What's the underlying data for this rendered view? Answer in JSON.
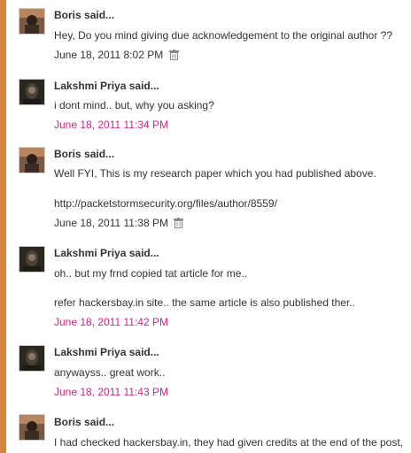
{
  "comments": [
    {
      "author": "Boris",
      "said": "said...",
      "lines": [
        "Hey, Do you mind giving due acknowledgement to the original author ??"
      ],
      "timestamp": "June 18, 2011 8:02 PM",
      "deletable": true,
      "avatar_icon": "boris-avatar-icon"
    },
    {
      "author": "Lakshmi Priya",
      "said": "said...",
      "lines": [
        "i dont mind.. but, why you asking?"
      ],
      "timestamp": "June 18, 2011 11:34 PM",
      "deletable": false,
      "avatar_icon": "lakshmi-avatar-icon"
    },
    {
      "author": "Boris",
      "said": "said...",
      "lines": [
        "Well FYI, This is my research paper which you had published above.",
        "http://packetstormsecurity.org/files/author/8559/"
      ],
      "timestamp": "June 18, 2011 11:38 PM",
      "deletable": true,
      "avatar_icon": "boris-avatar-icon"
    },
    {
      "author": "Lakshmi Priya",
      "said": "said...",
      "lines": [
        "oh.. but my frnd copied tat article for me..",
        "refer hackersbay.in site.. the same article is also published ther.."
      ],
      "timestamp": "June 18, 2011 11:42 PM",
      "deletable": false,
      "avatar_icon": "lakshmi-avatar-icon"
    },
    {
      "author": "Lakshmi Priya",
      "said": "said...",
      "lines": [
        "anywayss.. great work.."
      ],
      "timestamp": "June 18, 2011 11:43 PM",
      "deletable": false,
      "avatar_icon": "lakshmi-avatar-icon"
    },
    {
      "author": "Boris",
      "said": "said...",
      "lines": [
        "I had checked hackersbay.in, they had given credits at the end of the post,"
      ],
      "timestamp": "",
      "deletable": false,
      "avatar_icon": "boris-avatar-icon"
    }
  ],
  "colors": {
    "accent_bar": "#d1883a",
    "timestamp_link": "#c8278a",
    "text": "#333333"
  },
  "icons": {
    "delete": "trash-icon"
  }
}
